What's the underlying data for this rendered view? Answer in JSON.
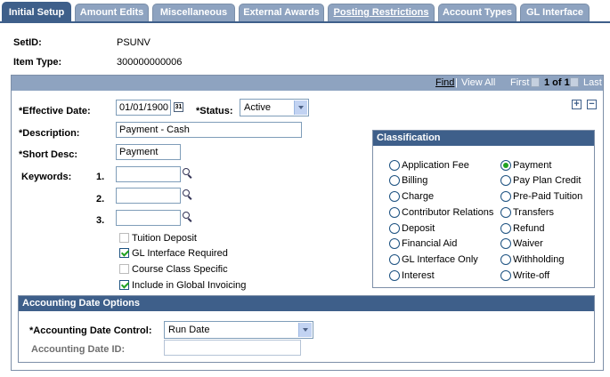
{
  "tabs": [
    {
      "label": "Initial Setup",
      "active": true
    },
    {
      "label": "Amount Edits"
    },
    {
      "label": "Miscellaneous"
    },
    {
      "label": "External Awards"
    },
    {
      "label": "Posting Restrictions"
    },
    {
      "label": "Account Types"
    },
    {
      "label": "GL Interface"
    }
  ],
  "header": {
    "setid_label": "SetID:",
    "setid_value": "PSUNV",
    "itemtype_label": "Item Type:",
    "itemtype_value": "300000000006"
  },
  "grid_nav": {
    "find": "Find",
    "separator": "|",
    "view_all": "View All",
    "first": "First",
    "range": "1 of 1",
    "last": "Last"
  },
  "form": {
    "effdate_label": "*Effective Date:",
    "effdate_value": "01/01/1900",
    "calendar_icon_text": "31",
    "status_label": "*Status:",
    "status_value": "Active",
    "description_label": "*Description:",
    "description_value": "Payment - Cash",
    "shortdesc_label": "*Short Desc:",
    "shortdesc_value": "Payment",
    "keywords_label": "Keywords:",
    "keyword_nums": [
      "1.",
      "2.",
      "3."
    ],
    "add_row": "+",
    "delete_row": "−"
  },
  "checkboxes": [
    {
      "label": "Tuition Deposit",
      "checked": false
    },
    {
      "label": "GL Interface Required",
      "checked": true
    },
    {
      "label": "Course Class Specific",
      "checked": false
    },
    {
      "label": "Include in Global Invoicing",
      "checked": true
    }
  ],
  "classification": {
    "title": "Classification",
    "left": [
      "Application Fee",
      "Billing",
      "Charge",
      "Contributor Relations",
      "Deposit",
      "Financial Aid",
      "GL Interface Only",
      "Interest"
    ],
    "right": [
      "Payment",
      "Pay Plan Credit",
      "Pre-Paid Tuition",
      "Transfers",
      "Refund",
      "Waiver",
      "Withholding",
      "Write-off"
    ],
    "selected": "Payment"
  },
  "accounting": {
    "title": "Accounting Date Options",
    "control_label": "*Accounting Date Control:",
    "control_value": "Run Date",
    "id_label": "Accounting Date ID:",
    "id_value": ""
  },
  "colors": {
    "tab_active": "#3e5f8a",
    "tab_inactive": "#8ea3c0",
    "check": "#21a121"
  }
}
